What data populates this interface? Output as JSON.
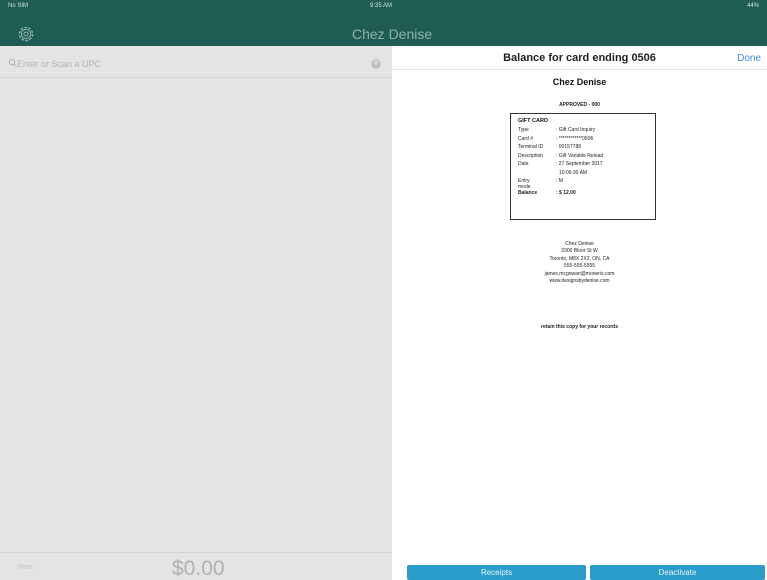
{
  "status_bar": {
    "carrier": "No SIM",
    "time": "9:35 AM",
    "battery": "44%"
  },
  "nav": {
    "title": "Chez Denise",
    "settings_icon": "gear-icon"
  },
  "search": {
    "placeholder": "Enter or Scan a UPC",
    "icon": "search-icon",
    "clear_icon": "clear-icon"
  },
  "footer": {
    "more_label": "More",
    "total": "$0.00"
  },
  "sheet": {
    "title": "Balance for card ending 0506",
    "done_label": "Done",
    "receipt": {
      "merchant": "Chez Denise",
      "status": "APPROVED - 000",
      "card_heading": "GIFT CARD",
      "fields": [
        {
          "label": "Type",
          "value": ": Gift Card Inquiry"
        },
        {
          "label": "Card #",
          "value": ": ************0506"
        },
        {
          "label": "Terminal ID",
          "value": ": 00157788"
        },
        {
          "label": "Description",
          "value": ": Gift Variable Reload"
        },
        {
          "label": "Date",
          "value": ": 27 September 2017"
        },
        {
          "label": "",
          "value": "10:06:30 AM"
        },
        {
          "label": "Entry mode",
          "value": ": M"
        },
        {
          "label": "Balance",
          "value": ": $ 12.00"
        }
      ],
      "address_lines": [
        "Chez Denise",
        "3300 Bloor St W",
        "Toronto, M8X 2X2, ON, CA",
        "555-555-5555",
        "james.mcgowan@moneris.com",
        "www.designsbydenise.com"
      ],
      "footer_note": "retain this copy for your records"
    },
    "buttons": {
      "receipts": "Receipts",
      "deactivate": "Deactivate"
    }
  },
  "colors": {
    "nav_bar": "#1f5c52",
    "accent_button": "#2a9cc9",
    "link": "#3b8ed9"
  }
}
